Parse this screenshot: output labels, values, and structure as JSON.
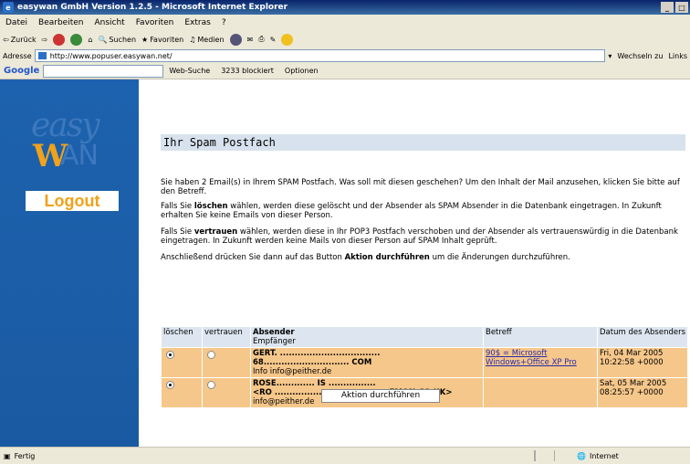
{
  "window": {
    "title": "easywan GmbH Version 1.2.5 - Microsoft Internet Explorer"
  },
  "menu": [
    "Datei",
    "Bearbeiten",
    "Ansicht",
    "Favoriten",
    "Extras",
    "?"
  ],
  "toolbar": {
    "back": "Zurück",
    "search": "Suchen",
    "favorites": "Favoriten",
    "media": "Medien"
  },
  "addressbar": {
    "label": "Adresse",
    "url": "http://www.popuser.easywan.net/",
    "go": "Wechseln zu",
    "links": "Links"
  },
  "googlebar": {
    "logo": "Google",
    "websearch": "Web-Suche",
    "blocked": "3233 blockiert",
    "options": "Optionen"
  },
  "sidebar": {
    "logout": "Logout",
    "logo_text_top": "easy",
    "logo_text_w": "W",
    "logo_text_an": "AN"
  },
  "main": {
    "title": "Ihr Spam Postfach",
    "para1": "Sie haben 2 Email(s) in Ihrem SPAM Postfach. Was soll mit diesen geschehen? Um den Inhalt der Mail anzusehen, klicken Sie bitte auf den Betreff.",
    "para2_a": "Falls Sie ",
    "para2_b": "löschen",
    "para2_c": " wählen, werden diese gelöscht und der Absender als SPAM Absender in die Datenbank eingetragen. In Zukunft erhalten Sie keine Emails von dieser Person.",
    "para3_a": "Falls Sie ",
    "para3_b": "vertrauen",
    "para3_c": " wählen, werden diese in Ihr POP3 Postfach verschoben und der Absender als vertrauenswürdig in die Datenbank eingetragen. In Zukunft werden keine Mails von dieser Person auf SPAM Inhalt geprüft.",
    "para4_a": "Anschließend drücken Sie dann auf das Button ",
    "para4_b": "Aktion durchführen",
    "para4_c": " um die Änderungen durchzuführen.",
    "table": {
      "headers": {
        "delete": "löschen",
        "trust": "vertrauen",
        "sender": "Absender",
        "recipient": "Empfänger",
        "subject": "Betreff",
        "date": "Datum des Absenders"
      },
      "rows": [
        {
          "sender1": "GERT. ..................................",
          "sender2": "68............................. COM",
          "recipient": "Info info@peither.de",
          "subject": "90$ = Microsoft Windows+Office XP Pro",
          "date": "Fri, 04 Mar 2005 10:22:58 +0000",
          "delete": true,
          "trust": false
        },
        {
          "sender1": "ROSE............. IS ................",
          "sender2": "<RO ...................................... EMON.CO.UK>",
          "recipient": "info@peither.de",
          "subject": "",
          "date": "Sat, 05 Mar 2005 08:25:57 +0000",
          "delete": true,
          "trust": false
        }
      ]
    },
    "action_button": "Aktion durchführen"
  },
  "status": {
    "left": "Fertig",
    "zone": "Internet"
  }
}
